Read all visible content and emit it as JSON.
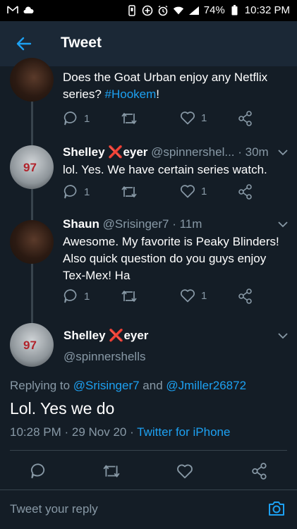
{
  "status_bar": {
    "icons_left": [
      "gmail-icon",
      "cloud-icon"
    ],
    "icons_right": [
      "vibrate-icon",
      "data-saver-icon",
      "alarm-icon",
      "wifi-icon",
      "signal-icon"
    ],
    "battery": "74%",
    "time": "10:32 PM"
  },
  "header": {
    "title": "Tweet",
    "back_icon": "arrow-left-icon"
  },
  "tweets": [
    {
      "text_pre": "Does the Goat Urban enjoy any Netflix series?  ",
      "hashtag": "#Hookem",
      "text_post": "!",
      "reply_count": "1",
      "like_count": "1"
    },
    {
      "name_a": "Shelley ",
      "name_x": "❌",
      "name_b": "eyer",
      "handle_time": " @spinnershel... · 30m",
      "text": "lol. Yes. We have certain series watch.",
      "reply_count": "1",
      "like_count": "1"
    },
    {
      "name": "Shaun",
      "handle_time": " @Srisinger7 · 11m",
      "text": "Awesome. My favorite is Peaky Blinders! Also quick question do you guys enjoy Tex-Mex! Ha",
      "reply_count": "1",
      "like_count": "1"
    }
  ],
  "main_tweet": {
    "name_a": "Shelley ",
    "name_x": "❌",
    "name_b": "eyer",
    "handle": "@spinnershells",
    "replying_prefix": "Replying to ",
    "replying_to_1": "@Srisinger7",
    "replying_and": " and ",
    "replying_to_2": "@Jmiller26872",
    "text": "Lol. Yes we do",
    "timestamp": "10:28 PM · 29 Nov 20 · ",
    "client": "Twitter for iPhone",
    "avatar_number": "97"
  },
  "reply_bar": {
    "placeholder": "Tweet your reply",
    "camera_icon": "camera-icon"
  },
  "colors": {
    "accent": "#1da1f2",
    "background": "#141d26",
    "secondary_text": "#8899a6",
    "border": "#38444d",
    "x_mark": "#e0245e"
  }
}
